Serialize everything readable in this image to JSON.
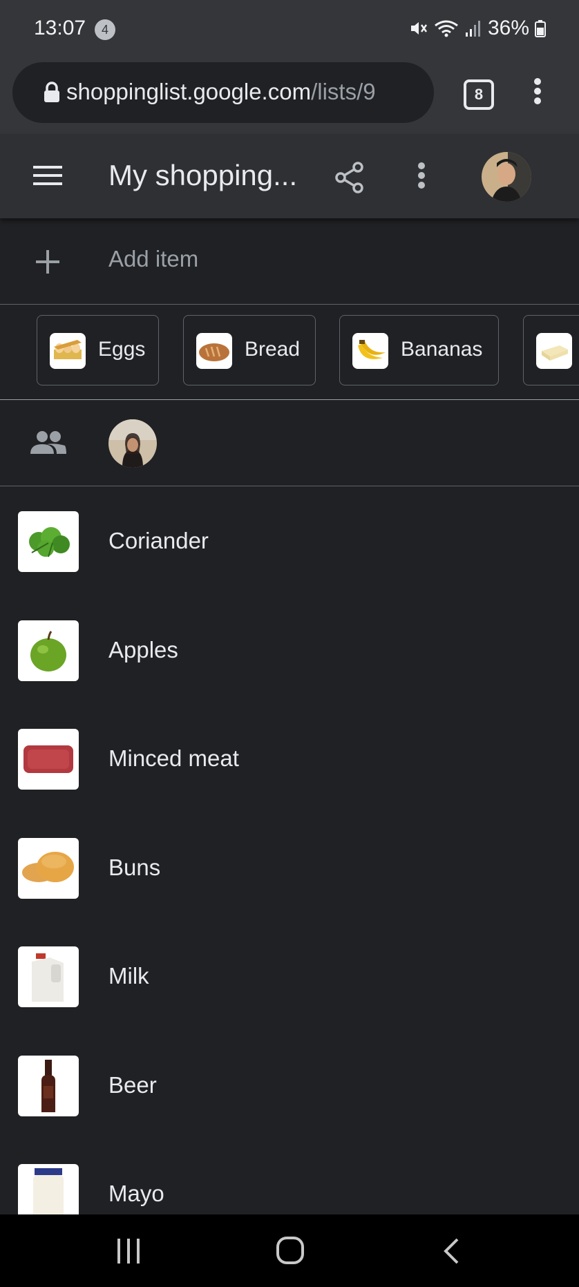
{
  "status_bar": {
    "time": "13:07",
    "notification_count": "4",
    "battery": "36%"
  },
  "browser": {
    "url_host": "shoppinglist.google.com",
    "url_path": "/lists/9",
    "tab_count": "8"
  },
  "app_bar": {
    "title": "My shopping..."
  },
  "add_item": {
    "label": "Add item"
  },
  "suggestions": [
    {
      "label": "Eggs",
      "icon": "eggs-icon"
    },
    {
      "label": "Bread",
      "icon": "bread-icon"
    },
    {
      "label": "Bananas",
      "icon": "bananas-icon"
    },
    {
      "label": "",
      "icon": "butter-icon"
    }
  ],
  "items": [
    {
      "label": "Coriander",
      "icon": "coriander-image"
    },
    {
      "label": "Apples",
      "icon": "apple-image"
    },
    {
      "label": "Minced meat",
      "icon": "minced-meat-image"
    },
    {
      "label": "Buns",
      "icon": "buns-image"
    },
    {
      "label": "Milk",
      "icon": "milk-image"
    },
    {
      "label": "Beer",
      "icon": "beer-image"
    },
    {
      "label": "Mayo",
      "icon": "mayo-image"
    }
  ],
  "colors": {
    "background": "#202124",
    "toolbar": "#2f3033",
    "status_bar": "#35363a",
    "text_primary": "#e8eaed",
    "text_secondary": "#9aa0a6"
  }
}
